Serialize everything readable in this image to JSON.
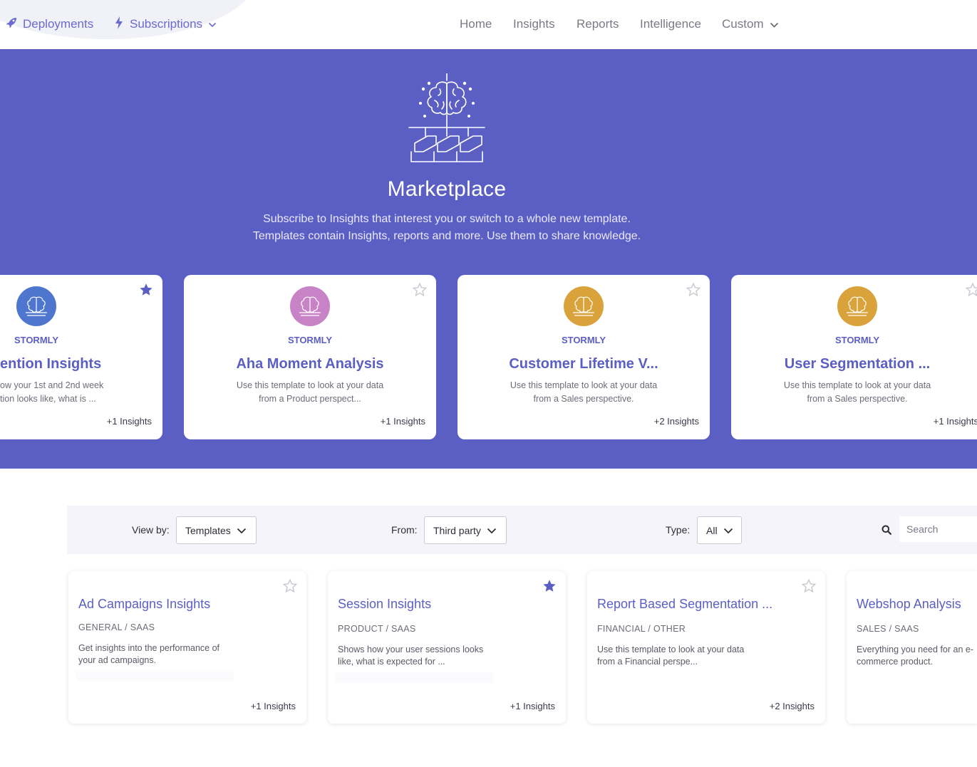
{
  "nav": {
    "left": [
      {
        "label": "Deployments",
        "icon": "rocket-icon"
      },
      {
        "label": "Subscriptions",
        "icon": "lightning-icon"
      }
    ],
    "right": [
      {
        "label": "Home"
      },
      {
        "label": "Insights"
      },
      {
        "label": "Reports"
      },
      {
        "label": "Intelligence"
      },
      {
        "label": "Custom"
      }
    ]
  },
  "hero": {
    "title": "Marketplace",
    "subtitle_line1": "Subscribe to Insights that interest you or switch to a whole new template.",
    "subtitle_line2": "Templates contain Insights, reports and more. Use them to share knowledge.",
    "icon": "brain-network-icon"
  },
  "featured": [
    {
      "vendor": "STORMLY",
      "title": "Retention Insights",
      "visible_title": "ention Insights",
      "desc_line1": "ow your 1st and 2nd week",
      "desc_line2": "tion looks like, what is ...",
      "count": "+1 Insights",
      "starred": true,
      "avatar_color": "#4f76cf"
    },
    {
      "vendor": "STORMLY",
      "title": "Aha Moment Analysis",
      "desc_line1": "Use this template to look at your data",
      "desc_line2": "from a Product perspect...",
      "count": "+1 Insights",
      "starred": false,
      "avatar_color": "#c883c6"
    },
    {
      "vendor": "STORMLY",
      "title": "Customer Lifetime V...",
      "desc_line1": "Use this template to look at your data",
      "desc_line2": "from a Sales perspective.",
      "count": "+2 Insights",
      "starred": false,
      "avatar_color": "#d9a23a"
    },
    {
      "vendor": "STORMLY",
      "title": "User Segmentation ...",
      "desc_line1": "Use this template to look at your data",
      "desc_line2": "from a Sales perspective.",
      "count": "+1 Insights",
      "starred": false,
      "avatar_color": "#d9a23a"
    }
  ],
  "filters": {
    "view_by_label": "View by:",
    "view_by_value": "Templates",
    "from_label": "From:",
    "from_value": "Third party",
    "type_label": "Type:",
    "type_value": "All",
    "search_placeholder": "Search"
  },
  "templates": [
    {
      "title": "Ad Campaigns Insights",
      "category": "GENERAL / SAAS",
      "desc_line1": "Get insights into the performance of",
      "desc_line2": "your ad campaigns.",
      "count": "+1 Insights",
      "starred": false
    },
    {
      "title": "Session Insights",
      "category": "PRODUCT / SAAS",
      "desc_line1": "Shows how your user sessions looks",
      "desc_line2": "like, what is expected for ...",
      "count": "+1 Insights",
      "starred": true
    },
    {
      "title": "Report Based Segmentation ...",
      "category": "FINANCIAL / OTHER",
      "desc_line1": "Use this template to look at your data",
      "desc_line2": "from a Financial perspe...",
      "count": "+2 Insights",
      "starred": false
    },
    {
      "title": "Webshop Analysis",
      "category": "SALES / SAAS",
      "desc_line1": "Everything you need for an e-",
      "desc_line2": "commerce product.",
      "count": "",
      "starred": false
    }
  ],
  "colors": {
    "brand": "#5b5fc4",
    "nav_accent": "#6a6ad0",
    "star_filled": "#5b5fc4",
    "star_empty": "#c6c6cf"
  }
}
